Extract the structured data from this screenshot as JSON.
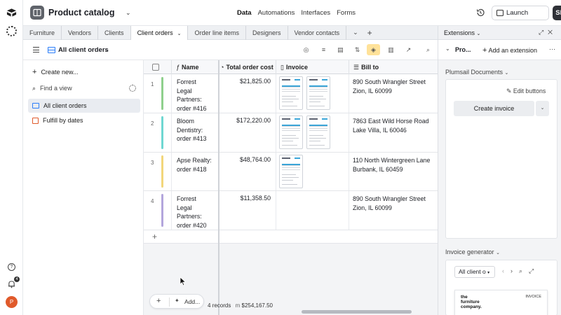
{
  "app": {
    "title": "Product catalog",
    "nav": [
      "Data",
      "Automations",
      "Interfaces",
      "Forms"
    ],
    "launch_label": "Launch",
    "share_label": "Share",
    "notification_count": "4",
    "avatar_initial": "P"
  },
  "tabs": [
    "Furniture",
    "Vendors",
    "Clients",
    "Client orders",
    "Order line items",
    "Designers",
    "Vendor contacts"
  ],
  "active_tab": "Client orders",
  "view": {
    "name": "All client orders"
  },
  "sidebar": {
    "create_label": "Create new...",
    "find_placeholder": "Find a view",
    "views": [
      "All client orders",
      "Fulfill by dates"
    ]
  },
  "grid": {
    "columns": [
      "Name",
      "Total order cost",
      "Invoice",
      "Bill to"
    ],
    "rows": [
      {
        "num": "1",
        "name": [
          "Forrest",
          "Legal",
          "Partners:",
          "order #416"
        ],
        "total": "$21,825.00",
        "addr1": "890 South Wrangler Street",
        "addr2": "Zion, IL 60099",
        "color": "#8fd08d",
        "thumbs": 2
      },
      {
        "num": "2",
        "name": [
          "Bloom",
          "Dentistry:",
          "order #413"
        ],
        "total": "$172,220.00",
        "addr1": "7863 East Wild Horse Road",
        "addr2": "Lake Villa, IL 60046",
        "color": "#6fd7d2",
        "thumbs": 2
      },
      {
        "num": "3",
        "name": [
          "Apse Realty:",
          "order #418"
        ],
        "total": "$48,764.00",
        "addr1": "110 North Wintergreen Lane",
        "addr2": "Burbank, IL 60459",
        "color": "#f2d67b",
        "thumbs": 1
      },
      {
        "num": "4",
        "name": [
          "Forrest",
          "Legal",
          "Partners:",
          "order #420"
        ],
        "total": "$11,358.50",
        "addr1": "890 South Wrangler Street",
        "addr2": "Zion, IL 60099",
        "color": "#b3a6dc",
        "thumbs": 0
      }
    ],
    "add_label": "Add...",
    "record_count": "4 records",
    "sum_prefix": "m",
    "sum_value": "$254,167.50"
  },
  "extensions": {
    "title": "Extensions",
    "sub_name": "Pro...",
    "add_extension_label": "Add an extension",
    "plumsail_label": "Plumsail Documents",
    "edit_buttons_label": "Edit buttons",
    "create_invoice_label": "Create invoice",
    "invoice_generator_label": "Invoice generator",
    "view_select": "All client o",
    "preview_brand": [
      "the",
      "furniture",
      "company."
    ],
    "preview_invoice": "INVOICE"
  },
  "colors": {
    "accent_blue": "#2d7ff9",
    "share_bg": "#2f3137",
    "active_filter": "#ffe299",
    "avatar": "#e05a2b"
  }
}
